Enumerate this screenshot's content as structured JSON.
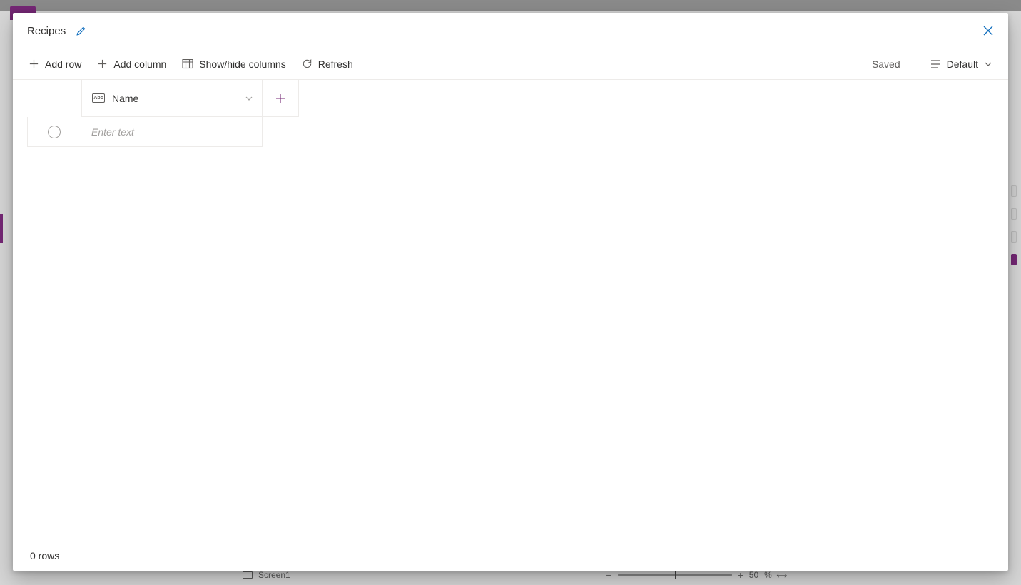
{
  "modal": {
    "title": "Recipes"
  },
  "toolbar": {
    "add_row": "Add row",
    "add_column": "Add column",
    "show_hide": "Show/hide columns",
    "refresh": "Refresh",
    "saved": "Saved",
    "view_label": "Default"
  },
  "columns": {
    "name": "Name",
    "type_abbr": "Abc"
  },
  "rows": {
    "placeholder": "Enter text"
  },
  "footer": {
    "row_count": "0 rows"
  },
  "background": {
    "screen_label": "Screen1",
    "zoom_value": "50",
    "zoom_unit": "%"
  }
}
